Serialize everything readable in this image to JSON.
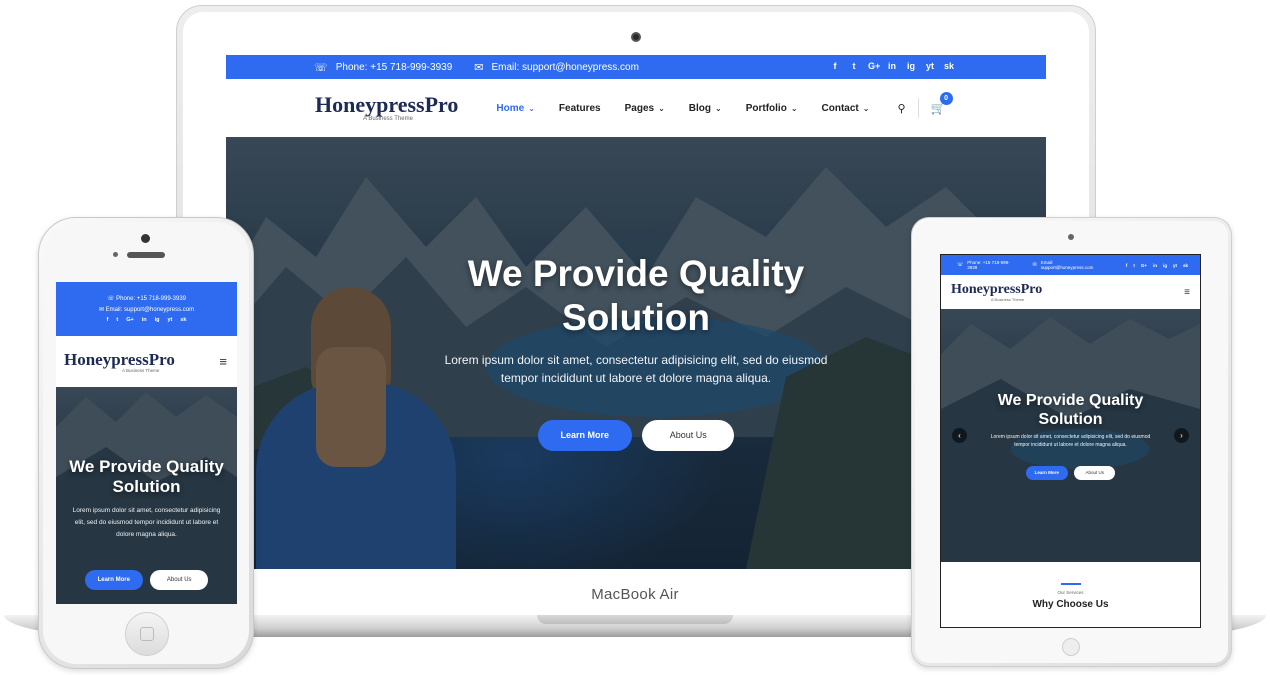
{
  "site": {
    "phone": "Phone: +15 718-999-3939",
    "email": "Email: support@honeypress.com",
    "social_icons": [
      "f",
      "t",
      "G+",
      "in",
      "ig",
      "yt",
      "sk"
    ],
    "social_names": [
      "facebook-icon",
      "twitter-icon",
      "google-plus-icon",
      "linkedin-icon",
      "instagram-icon",
      "youtube-icon",
      "skype-icon"
    ],
    "logo_main": "Honeypress",
    "logo_pro": "Pro",
    "logo_tagline": "A Business Theme",
    "nav": [
      {
        "label": "Home",
        "caret": true,
        "active": true
      },
      {
        "label": "Features",
        "caret": false,
        "active": false
      },
      {
        "label": "Pages",
        "caret": true,
        "active": false
      },
      {
        "label": "Blog",
        "caret": true,
        "active": false
      },
      {
        "label": "Portfolio",
        "caret": true,
        "active": false
      },
      {
        "label": "Contact",
        "caret": true,
        "active": false
      }
    ],
    "cart_count": "0",
    "hero_title_line1": "We Provide Quality",
    "hero_title_line2": "Solution",
    "hero_text_line1": "Lorem ipsum dolor sit amet, consectetur adipisicing elit, sed do eiusmod",
    "hero_text_line2": "tempor incididunt ut labore et dolore magna aliqua.",
    "hero_text_mobile_l1": "Lorem ipsum dolor sit amet, consectetur adipisicing",
    "hero_text_mobile_l2": "elit, sed do eiusmod tempor incididunt ut labore et",
    "hero_text_mobile_l3": "dolore magna aliqua.",
    "btn_learn": "Learn More",
    "btn_about": "About Us",
    "services_sub": "Our Services",
    "services_title": "Why Choose Us",
    "colors": {
      "primary": "#2e6bf0",
      "dark": "#1c2a55"
    }
  },
  "devices": {
    "laptop_brand": "MacBook Air"
  }
}
